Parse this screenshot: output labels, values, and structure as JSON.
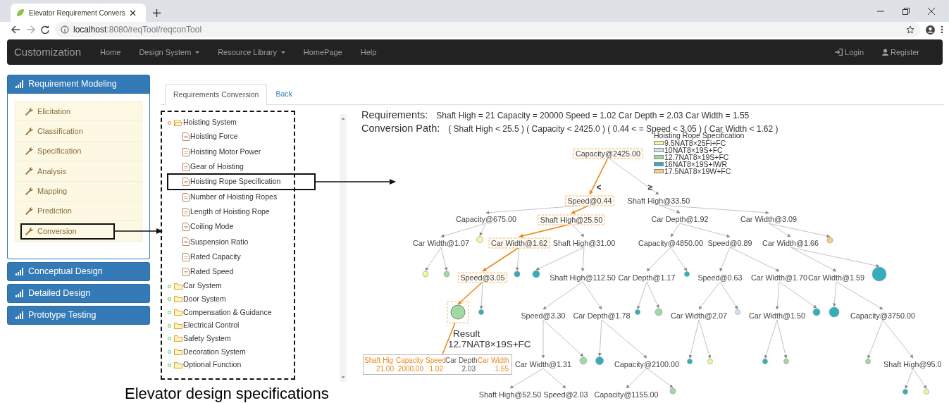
{
  "browser": {
    "tab_title": "Elevator Requirement Convers",
    "url_host": "localhost",
    "url_path": ":8080/reqTool/reqconTool"
  },
  "navbar": {
    "brand": "Customization",
    "items": [
      {
        "label": "Home",
        "kind": "link"
      },
      {
        "label": "Design System",
        "kind": "dropdown"
      },
      {
        "label": "Resource Library",
        "kind": "dropdown"
      },
      {
        "label": "HomePage",
        "kind": "link"
      },
      {
        "label": "Help",
        "kind": "link"
      }
    ],
    "right_items": [
      {
        "label": "Login",
        "kind": "login"
      },
      {
        "label": "Register",
        "kind": "register"
      }
    ]
  },
  "sidebar": {
    "sections": [
      {
        "title": "Requirement Modeling",
        "expanded": true,
        "items": [
          {
            "label": "Elicitation",
            "callout": false
          },
          {
            "label": "Classification",
            "callout": false
          },
          {
            "label": "Specification",
            "callout": false
          },
          {
            "label": "Analysis",
            "callout": false
          },
          {
            "label": "Mapping",
            "callout": false
          },
          {
            "label": "Prediction",
            "callout": false
          },
          {
            "label": "Conversion",
            "callout": true
          }
        ]
      },
      {
        "title": "Conceptual Design",
        "expanded": false
      },
      {
        "title": "Detailed Design",
        "expanded": false
      },
      {
        "title": "Prototype Testing",
        "expanded": false
      }
    ]
  },
  "tabs": [
    {
      "label": "Requirements Conversion",
      "selected": true
    },
    {
      "label": "Back",
      "selected": false
    }
  ],
  "spec_tree": [
    {
      "label": "Hoisting System",
      "expanded": true,
      "children": [
        {
          "label": "Hoisting Force",
          "callout": false
        },
        {
          "label": "Hoisting Motor Power",
          "callout": false
        },
        {
          "label": "Gear of Hoisting",
          "callout": false
        },
        {
          "label": "Hoisting Rope Specification",
          "callout": true
        },
        {
          "label": "Number of Hoisting Ropes",
          "callout": false
        },
        {
          "label": "Length of Hoisting Rope",
          "callout": false
        },
        {
          "label": "Coiling Mode",
          "callout": false
        },
        {
          "label": "Suspension Ratio",
          "callout": false
        },
        {
          "label": "Rated Capacity",
          "callout": false
        },
        {
          "label": "Rated Speed",
          "callout": false
        }
      ]
    },
    {
      "label": "Car System",
      "expanded": false
    },
    {
      "label": "Door System",
      "expanded": false
    },
    {
      "label": "Compensation & Guidance",
      "expanded": false
    },
    {
      "label": "Electrical Control",
      "expanded": false
    },
    {
      "label": "Safety System",
      "expanded": false
    },
    {
      "label": "Decoration System",
      "expanded": false
    },
    {
      "label": "Optional Function",
      "expanded": false
    }
  ],
  "requirements": {
    "label": "Requirements:",
    "text": "Shaft High = 21 Capacity = 20000 Speed = 1.02 Car Depth = 2.03 Car Width = 1.55"
  },
  "conversion_path": {
    "label": "Conversion Path:",
    "text": "( Shaft High < 25.5 ) ( Capacity < 2425.0 ) ( 0.44 < = Speed < 3.05 ) ( Car Width < 1.62 )"
  },
  "legend": {
    "title": "Hoisting Rope Specification",
    "items": [
      {
        "label": "9.5NAT8×25Fi+FC",
        "color": "#f7f3a0"
      },
      {
        "label": "10NAT8×19S+FC",
        "color": "#d4e0f4"
      },
      {
        "label": "12.7NAT8×19S+FC",
        "color": "#a1d9a5"
      },
      {
        "label": "16NAT8×19S+IWR",
        "color": "#35aebb"
      },
      {
        "label": "17.5NAT8×19W+FC",
        "color": "#f6d177"
      }
    ]
  },
  "decision_tree": {
    "kind": "split",
    "label": "Capacity@2425.00",
    "on_path": true,
    "children": [
      {
        "kind": "split",
        "label": "Speed@0.44",
        "on_path": true,
        "branch": "<",
        "children": [
          {
            "kind": "split",
            "label": "Capacity@675.00",
            "on_path": false,
            "children": [
              {
                "kind": "split",
                "label": "Car Width@1.07",
                "on_path": false,
                "children": [
                  {
                    "kind": "leaf",
                    "color": "#f7f3a0",
                    "on_path": false
                  },
                  {
                    "kind": "leaf",
                    "color": "#a1d9a5",
                    "on_path": false
                  }
                ]
              },
              {
                "kind": "leaf",
                "color": "#f7f3a0",
                "on_path": false
              }
            ]
          },
          {
            "kind": "split",
            "label": "Shaft High@25.50",
            "on_path": true,
            "children": [
              {
                "kind": "split",
                "label": "Car Width@1.62",
                "on_path": true,
                "children": [
                  {
                    "kind": "split",
                    "label": "Speed@3.05",
                    "on_path": true,
                    "children": [
                      {
                        "kind": "leaf",
                        "color": "#a1d9a5",
                        "on_path": true
                      },
                      {
                        "kind": "leaf",
                        "color": "#35aebb",
                        "on_path": false
                      }
                    ]
                  },
                  {
                    "kind": "leaf",
                    "color": "#35aebb",
                    "on_path": false
                  }
                ]
              },
              {
                "kind": "split",
                "label": "Shaft High@31.00",
                "on_path": false,
                "children": [
                  {
                    "kind": "leaf",
                    "color": "#35aebb",
                    "on_path": false
                  },
                  {
                    "kind": "split",
                    "label": "Shaft High@112.50",
                    "on_path": false,
                    "children": [
                      {
                        "kind": "split",
                        "label": "Speed@3.30",
                        "on_path": false,
                        "children": [
                          {
                            "kind": "split",
                            "label": "Car Width@1.31",
                            "on_path": false,
                            "children": [
                              {
                                "kind": "split",
                                "label": "Shaft High@52.50",
                                "on_path": false
                              },
                              {
                                "kind": "split",
                                "label": "Speed@2.03",
                                "on_path": false
                              }
                            ]
                          },
                          {
                            "kind": "leaf",
                            "color": "#a1d9a5",
                            "on_path": false
                          }
                        ]
                      },
                      {
                        "kind": "split",
                        "label": "Car Depth@1.78",
                        "on_path": false,
                        "children": [
                          {
                            "kind": "leaf",
                            "color": "#35aebb",
                            "on_path": false
                          },
                          {
                            "kind": "split",
                            "label": "Capacity@2100.00",
                            "on_path": false,
                            "children": [
                              {
                                "kind": "split",
                                "label": "Capacity@1155.00",
                                "on_path": false
                              },
                              {
                                "kind": "leaf",
                                "color": "#a1d9a5",
                                "on_path": false
                              }
                            ]
                          }
                        ]
                      }
                    ]
                  }
                ]
              }
            ]
          }
        ]
      },
      {
        "kind": "split",
        "label": "Shaft High@33.50",
        "on_path": false,
        "branch": "≥",
        "children": [
          {
            "kind": "split",
            "label": "Car Depth@1.92",
            "on_path": false,
            "children": [
              {
                "kind": "split",
                "label": "Capacity@4850.00",
                "on_path": false,
                "children": [
                  {
                    "kind": "split",
                    "label": "Car Depth@1.17",
                    "on_path": false,
                    "children": [
                      {
                        "kind": "leaf",
                        "color": "#35aebb",
                        "on_path": false
                      },
                      {
                        "kind": "leaf",
                        "color": "#a1d9a5",
                        "on_path": false
                      }
                    ]
                  },
                  {
                    "kind": "leaf",
                    "color": "#35aebb",
                    "on_path": false
                  }
                ]
              },
              {
                "kind": "split",
                "label": "Speed@0.89",
                "on_path": false,
                "children": [
                  {
                    "kind": "split",
                    "label": "Speed@0.63",
                    "on_path": false,
                    "children": [
                      {
                        "kind": "split",
                        "label": "Car Width@2.07",
                        "on_path": false,
                        "children": [
                          {
                            "kind": "leaf",
                            "color": "#35aebb",
                            "on_path": false
                          },
                          {
                            "kind": "leaf",
                            "color": "#f7f3a0",
                            "on_path": false
                          }
                        ]
                      },
                      {
                        "kind": "leaf",
                        "color": "#d4e0f4",
                        "on_path": false
                      }
                    ]
                  },
                  {
                    "kind": "split",
                    "label": "Car Width@1.70",
                    "on_path": false,
                    "children": [
                      {
                        "kind": "split",
                        "label": "Car Width@1.50",
                        "on_path": false,
                        "children": [
                          {
                            "kind": "leaf",
                            "color": "#35aebb",
                            "on_path": false
                          },
                          {
                            "kind": "leaf",
                            "color": "#a1d9a5",
                            "on_path": false
                          }
                        ]
                      },
                      {
                        "kind": "leaf",
                        "color": "#35aebb",
                        "on_path": false
                      }
                    ]
                  }
                ]
              }
            ]
          },
          {
            "kind": "split",
            "label": "Car Width@3.09",
            "on_path": false,
            "children": [
              {
                "kind": "split",
                "label": "Car Width@1.66",
                "on_path": false,
                "children": [
                  {
                    "kind": "split",
                    "label": "Car Width@1.59",
                    "on_path": false,
                    "children": [
                      {
                        "kind": "leaf",
                        "color": "#35aebb",
                        "on_path": false
                      },
                      {
                        "kind": "split",
                        "label": "Capacity@3750.00",
                        "on_path": false,
                        "children": [
                          {
                            "kind": "leaf",
                            "color": "#a1d9a5",
                            "on_path": false
                          },
                          {
                            "kind": "split",
                            "label": "Shaft High@95.0",
                            "on_path": false,
                            "children": [
                              {
                                "kind": "leaf",
                                "color": "#35aebb",
                                "on_path": false
                              },
                              {
                                "kind": "leaf",
                                "color": "#f7f3a0",
                                "on_path": false
                              }
                            ]
                          }
                        ]
                      }
                    ]
                  },
                  {
                    "kind": "leaf",
                    "color": "#35aebb",
                    "on_path": false
                  }
                ]
              },
              {
                "kind": "leaf",
                "color": "#f6d177",
                "on_path": false
              }
            ]
          }
        ]
      }
    ]
  },
  "result": {
    "label": "Result",
    "value": "12.7NAT8×19S+FC",
    "columns": [
      {
        "name": "Shaft Hig",
        "value": "21.00",
        "highlighted": true
      },
      {
        "name": "Capacity",
        "value": "2000.00",
        "highlighted": true
      },
      {
        "name": "Speed",
        "value": "1.02",
        "highlighted": true
      },
      {
        "name": "Car Depth",
        "value": "2.03",
        "highlighted": false
      },
      {
        "name": "Car Width",
        "value": "1.55",
        "highlighted": true
      }
    ]
  },
  "caption": "Elevator design specifications"
}
